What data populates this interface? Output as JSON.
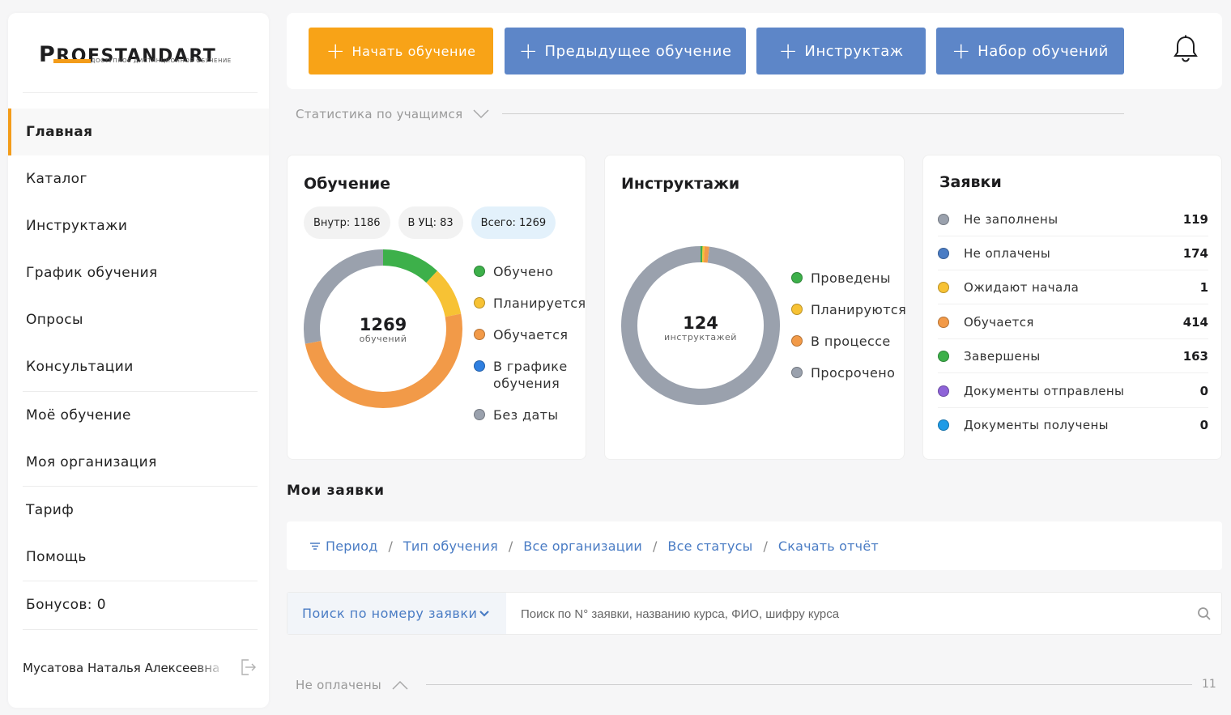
{
  "logo": {
    "brand_p": "P",
    "brand_rest": "ROFSTANDART",
    "tagline": "ДОСТУПНОЕ ДИСТАНЦИОННОЕ ОБУЧЕНИЕ"
  },
  "sidebar": {
    "items": [
      {
        "label": "Главная"
      },
      {
        "label": "Каталог"
      },
      {
        "label": "Инструктажи"
      },
      {
        "label": "График обучения"
      },
      {
        "label": "Опросы"
      },
      {
        "label": "Консультации"
      },
      {
        "label": "Моё обучение"
      },
      {
        "label": "Моя организация"
      },
      {
        "label": "Тариф"
      },
      {
        "label": "Помощь"
      },
      {
        "label": "Бонусов: 0"
      }
    ],
    "active_index": 0,
    "user_name": "Мусатова Наталья Алексеевна",
    "accent_color": "#f39c1a"
  },
  "topbar": {
    "buttons": [
      {
        "label": "Начать обучение"
      },
      {
        "label": "Предыдущее обучение"
      },
      {
        "label": "Инструктаж"
      },
      {
        "label": "Набор обучений"
      }
    ],
    "colors": {
      "primary": "#f8a317",
      "secondary": "#5d86c8"
    }
  },
  "stats_section": {
    "label": "Статистика по учащимся"
  },
  "training_card": {
    "title": "Обучение",
    "chips": [
      "Внутр: 1186",
      "В УЦ: 83",
      "Всего: 1269"
    ],
    "total": "1269",
    "total_unit": "обучений",
    "legend": [
      {
        "label": "Обучено",
        "color": "#3db04a"
      },
      {
        "label": "Планируется",
        "color": "#f7c234"
      },
      {
        "label": "Обучается",
        "color": "#f29a48"
      },
      {
        "label": "В графике обучения",
        "color": "#2f7fe0"
      },
      {
        "label": "Без даты",
        "color": "#9aa1ad"
      }
    ],
    "donut": {
      "slices": [
        {
          "name": "Обучено",
          "value": 152,
          "color": "#3db04a"
        },
        {
          "name": "Планируется",
          "value": 127,
          "color": "#f7c234"
        },
        {
          "name": "Обучается",
          "value": 634,
          "color": "#f29a48"
        },
        {
          "name": "В графике обучения",
          "value": 0,
          "color": "#2f7fe0"
        },
        {
          "name": "Без даты",
          "value": 356,
          "color": "#9aa1ad"
        }
      ]
    }
  },
  "instr_card": {
    "title": "Инструктажи",
    "total": "124",
    "total_unit": "инструктажей",
    "legend": [
      {
        "label": "Проведены",
        "color": "#3db04a"
      },
      {
        "label": "Планируются",
        "color": "#f7c234"
      },
      {
        "label": "В процессе",
        "color": "#f29a48"
      },
      {
        "label": "Просрочено",
        "color": "#9aa1ad"
      }
    ],
    "donut": {
      "slices": [
        {
          "name": "Проведены",
          "value": 0.5,
          "color": "#3db04a"
        },
        {
          "name": "Планируются",
          "value": 0.5,
          "color": "#f7c234"
        },
        {
          "name": "В процессе",
          "value": 1.2,
          "color": "#f29a48"
        },
        {
          "name": "Просрочено",
          "value": 121.8,
          "color": "#9aa1ad"
        }
      ]
    }
  },
  "requests_card": {
    "title": "Заявки",
    "rows": [
      {
        "label": "Не заполнены",
        "count": "119",
        "color": "#9aa1ad"
      },
      {
        "label": "Не оплачены",
        "count": "174",
        "color": "#4a7cc4"
      },
      {
        "label": "Ожидают начала",
        "count": "1",
        "color": "#f7c234"
      },
      {
        "label": "Обучается",
        "count": "414",
        "color": "#f29a48"
      },
      {
        "label": "Завершены",
        "count": "163",
        "color": "#3db04a"
      },
      {
        "label": "Документы отправлены",
        "count": "0",
        "color": "#8e63d8"
      },
      {
        "label": "Документы получены",
        "count": "0",
        "color": "#1e9be6"
      }
    ]
  },
  "my_requests": {
    "title": "Мои заявки",
    "filters": [
      "Период",
      "Тип обучения",
      "Все организации",
      "Все статусы",
      "Скачать отчёт"
    ],
    "separator": "/",
    "search_mode": "Поиск по номеру заявки",
    "search_placeholder": "Поиск по N° заявки, названию курса, ФИО, шифру курса"
  },
  "unpaid_section": {
    "label": "Не оплачены",
    "count": "11"
  }
}
